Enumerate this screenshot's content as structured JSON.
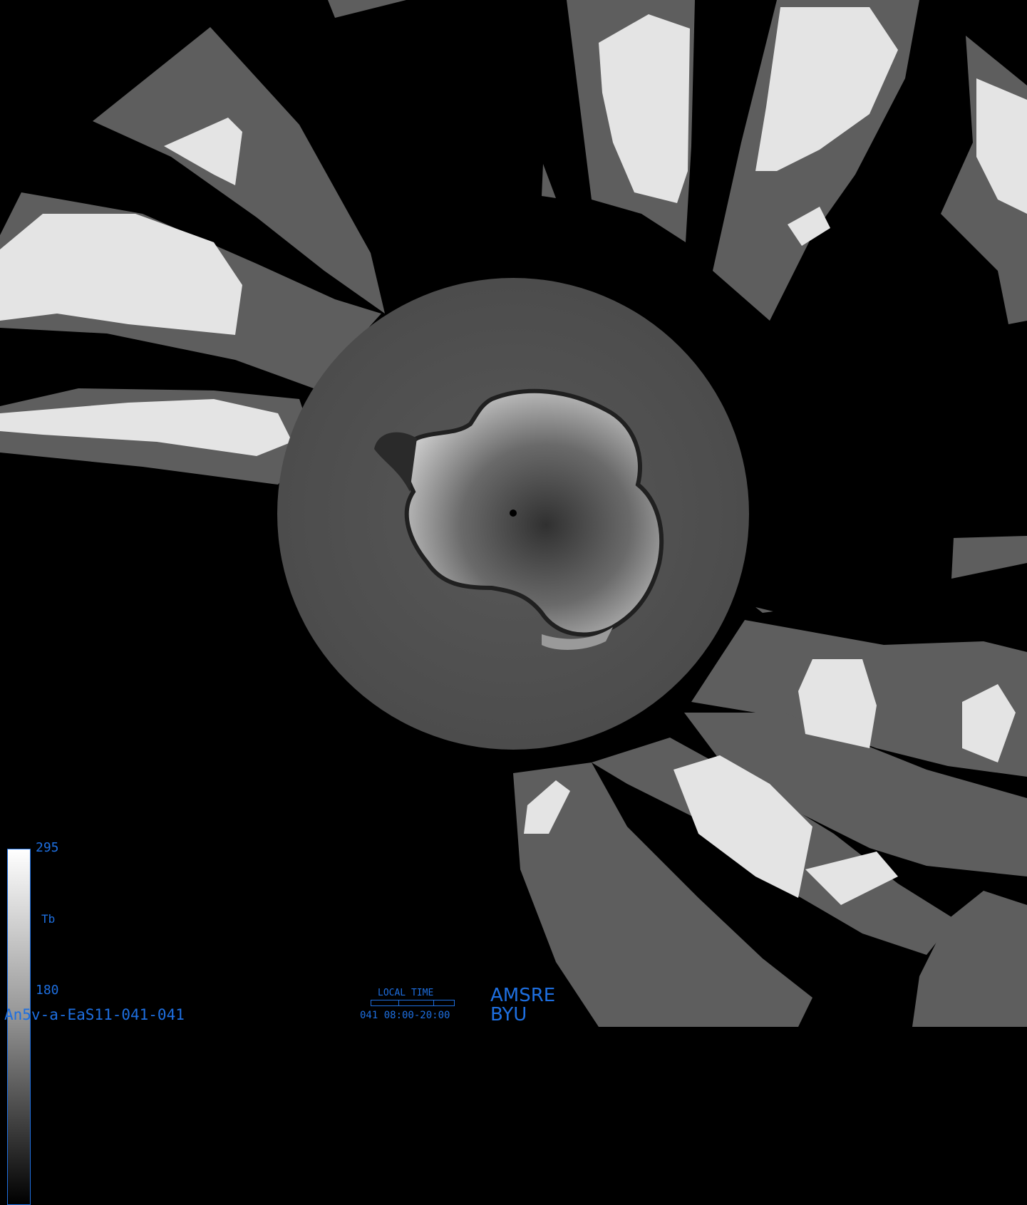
{
  "colorbar": {
    "max_label": "295",
    "variable_label": "Tb",
    "min_label": "180",
    "colors": {
      "high": "#ffffff",
      "low": "#000000",
      "frame": "#1e6fe0"
    }
  },
  "product_id": "An5v-a-EaS11-041-041",
  "time_legend": {
    "title": "LOCAL TIME",
    "text": "041 08:00-20:00"
  },
  "credits": {
    "sensor": "AMSRE",
    "institution": "BYU"
  },
  "colors": {
    "label_blue": "#1e6fe0",
    "background": "#000000",
    "ocean_gray": "#5a5a5a",
    "land_white": "#e6e6e6"
  }
}
